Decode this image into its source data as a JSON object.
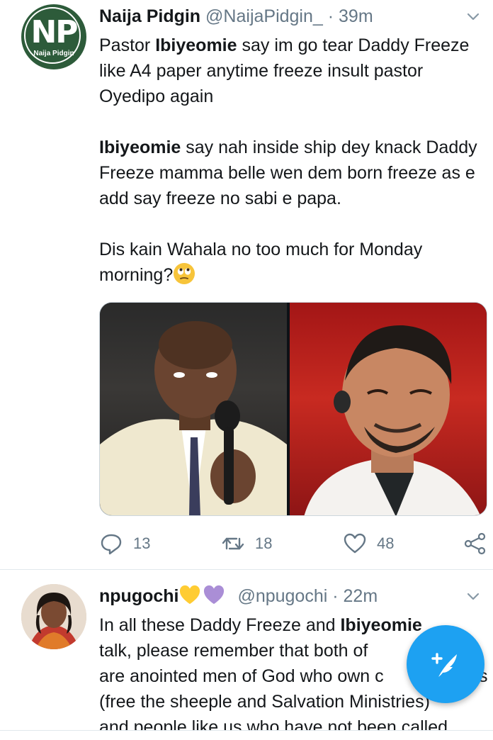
{
  "tweet1": {
    "display_name": "Naija Pidgin",
    "handle": "@NaijaPidgin_",
    "separator": "·",
    "time": "39m",
    "avatar_letters": "NP",
    "avatar_caption": "Naija Pidgin",
    "p1_a": "Pastor ",
    "p1_b": "Ibiyeomie",
    "p1_c": " say im go tear Daddy Freeze like A4 paper anytime freeze insult pastor Oyedipo again",
    "p2_a": "Ibiyeomie",
    "p2_b": " say nah inside ship dey knack Daddy Freeze mamma belle wen dem born freeze as e add say freeze no sabi e papa.",
    "p3_a": "Dis kain Wahala no too much for  Monday morning?",
    "p3_emoji": "face-with-rolling-eyes",
    "replies": "13",
    "retweets": "18",
    "likes": "48"
  },
  "tweet2": {
    "display_name": "npugochi",
    "name_emojis": [
      "yellow-heart",
      "purple-heart"
    ],
    "handle": "@npugochi",
    "separator": "·",
    "time": "22m",
    "line1_a": "In all these Daddy Freeze and ",
    "line1_b": "Ibiyeomie",
    "line2": " talk, please remember that both of",
    "line3": "are anointed men of God who own c",
    "line3_tail": "s",
    "line4": "(free the sheeple and Salvation Ministries)",
    "line5": "and people like us who have not been called"
  },
  "colors": {
    "accent": "#1da1f2",
    "secondary_text": "#657786",
    "primary_text": "#14171a",
    "avatar_green": "#2d5b3a"
  },
  "fab": {
    "icon": "compose-feather-plus-icon"
  }
}
